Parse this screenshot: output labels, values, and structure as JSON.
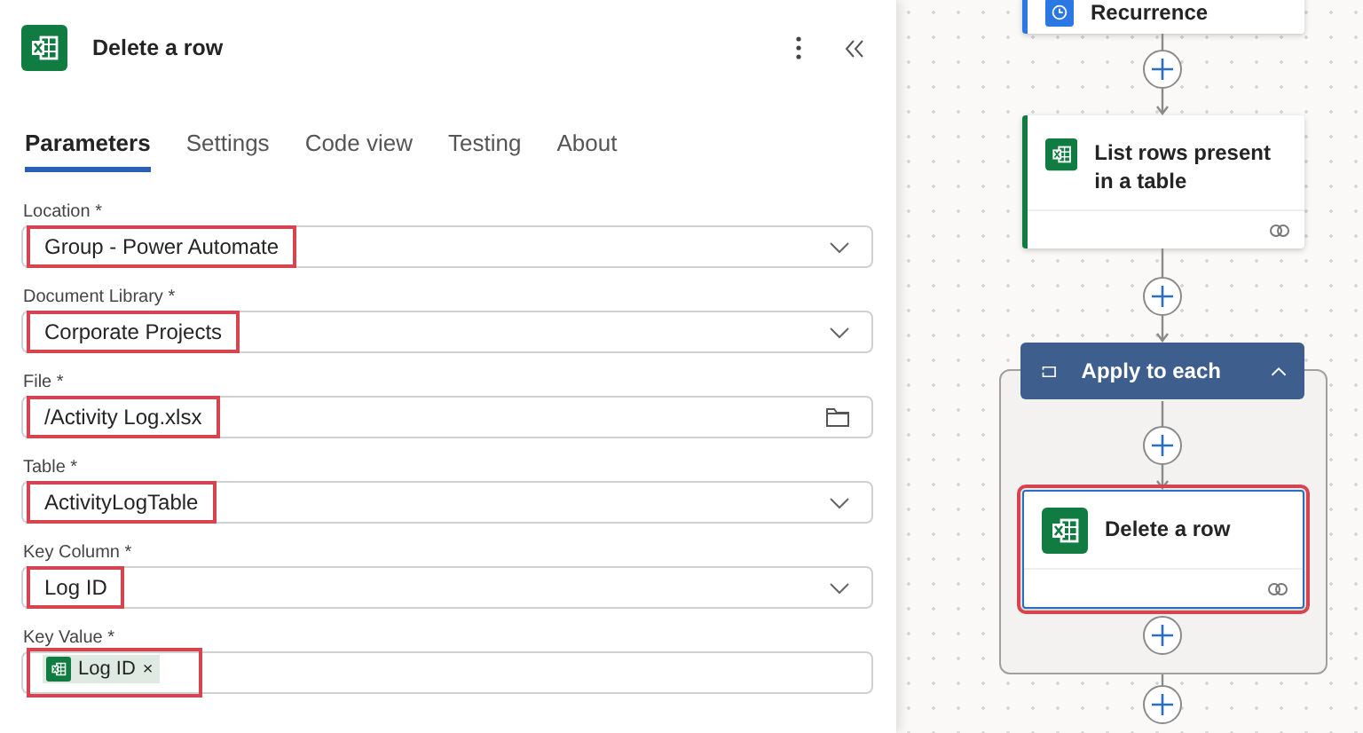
{
  "panel": {
    "title": "Delete a row",
    "tabs": [
      {
        "label": "Parameters",
        "selected": true
      },
      {
        "label": "Settings",
        "selected": false
      },
      {
        "label": "Code view",
        "selected": false
      },
      {
        "label": "Testing",
        "selected": false
      },
      {
        "label": "About",
        "selected": false
      }
    ],
    "fields": [
      {
        "label": "Location *",
        "kind": "dropdown",
        "value": "Group - Power Automate",
        "highlighted": true
      },
      {
        "label": "Document Library *",
        "kind": "dropdown",
        "value": "Corporate Projects",
        "highlighted": true
      },
      {
        "label": "File *",
        "kind": "file",
        "value": "/Activity Log.xlsx",
        "highlighted": true
      },
      {
        "label": "Table *",
        "kind": "dropdown",
        "value": "ActivityLogTable",
        "highlighted": true
      },
      {
        "label": "Key Column *",
        "kind": "dropdown",
        "value": "Log ID",
        "highlighted": true
      },
      {
        "label": "Key Value *",
        "kind": "token",
        "token": {
          "label": "Log ID",
          "remove": "×"
        },
        "highlighted": true
      }
    ]
  },
  "canvas": {
    "steps": [
      {
        "title": "Recurrence",
        "kind": "trigger"
      },
      {
        "title": "List rows present in a table",
        "kind": "excel",
        "highlighted": false
      },
      {
        "title": "Apply to each",
        "kind": "loop",
        "expanded": true,
        "children": [
          {
            "title": "Delete a row",
            "kind": "excel",
            "highlighted": true
          }
        ]
      }
    ]
  }
}
